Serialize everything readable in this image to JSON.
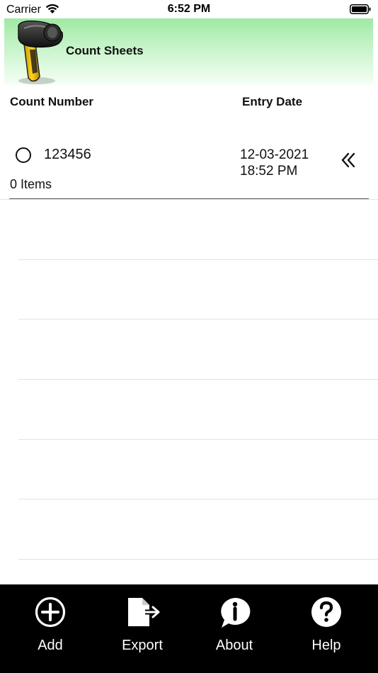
{
  "status_bar": {
    "carrier": "Carrier",
    "time": "6:52 PM"
  },
  "header": {
    "title": "Count Sheets",
    "gradient_top": "#9fe9a3",
    "gradient_bottom": "#f6fff6"
  },
  "columns": {
    "count_number": "Count Number",
    "entry_date": "Entry Date"
  },
  "records": [
    {
      "count_number": "123456",
      "date": "12-03-2021",
      "time": "18:52 PM",
      "items": "0 Items",
      "selected": false
    }
  ],
  "toolbar": {
    "background": "#000000",
    "add_label": "Add",
    "export_label": "Export",
    "about_label": "About",
    "help_label": "Help"
  },
  "icons": {
    "wifi": "wifi-icon",
    "battery": "battery-icon",
    "scanner": "barcode-scanner-icon",
    "expand": "double-chevron-left-icon",
    "add": "plus-circle-icon",
    "export": "export-icon",
    "about": "info-bubble-icon",
    "help": "question-circle-icon"
  }
}
